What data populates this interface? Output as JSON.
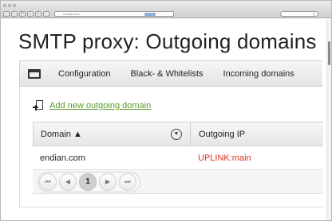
{
  "browser": {
    "url": "endian.com",
    "search_placeholder": "Q"
  },
  "page": {
    "title": "SMTP proxy: Outgoing domains"
  },
  "tabs": [
    {
      "label": "Configuration"
    },
    {
      "label": "Black- & Whitelists"
    },
    {
      "label": "Incoming domains"
    }
  ],
  "actions": {
    "add_label": "Add new outgoing domain"
  },
  "table": {
    "columns": [
      "Domain ▲",
      "Outgoing IP"
    ],
    "rows": [
      {
        "domain": "endian.com",
        "outgoing_ip": "UPLINK:main"
      }
    ]
  },
  "pager": {
    "first": "⏮",
    "prev": "◀",
    "current": "1",
    "next": "▶",
    "last": "⏭"
  },
  "colors": {
    "link": "#5a9a2c",
    "uplink": "#e0301e"
  },
  "icons": [
    "folder-icon",
    "add-document-icon",
    "filter-icon",
    "sort-up-icon"
  ]
}
